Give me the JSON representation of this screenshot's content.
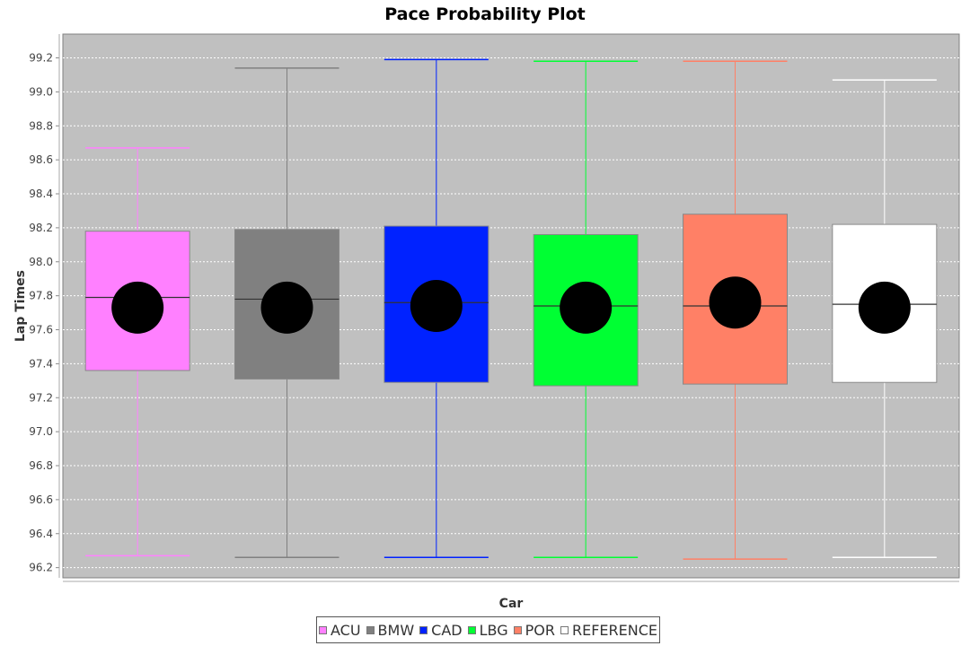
{
  "chart_data": {
    "type": "box",
    "title": "Pace Probability Plot",
    "xlabel": "Car",
    "ylabel": "Lap Times",
    "ylim": [
      96.14,
      99.34
    ],
    "y_ticks": [
      96.2,
      96.4,
      96.6,
      96.8,
      97.0,
      97.2,
      97.4,
      97.6,
      97.8,
      98.0,
      98.2,
      98.4,
      98.6,
      98.8,
      99.0,
      99.2
    ],
    "grid": true,
    "legend_position": "bottom",
    "series": [
      {
        "name": "ACU",
        "color": "#ff80ff",
        "min": 96.27,
        "q1": 97.36,
        "median": 97.79,
        "q3": 98.18,
        "max": 98.67,
        "mean": 97.73
      },
      {
        "name": "BMW",
        "color": "#808080",
        "min": 96.26,
        "q1": 97.31,
        "median": 97.78,
        "q3": 98.19,
        "max": 99.14,
        "mean": 97.73
      },
      {
        "name": "CAD",
        "color": "#0022ff",
        "min": 96.26,
        "q1": 97.29,
        "median": 97.76,
        "q3": 98.21,
        "max": 99.19,
        "mean": 97.74
      },
      {
        "name": "LBG",
        "color": "#00ff33",
        "min": 96.26,
        "q1": 97.27,
        "median": 97.74,
        "q3": 98.16,
        "max": 99.18,
        "mean": 97.73
      },
      {
        "name": "POR",
        "color": "#ff8066",
        "min": 96.25,
        "q1": 97.28,
        "median": 97.74,
        "q3": 98.28,
        "max": 99.18,
        "mean": 97.76
      },
      {
        "name": "REFERENCE",
        "color": "#ffffff",
        "min": 96.26,
        "q1": 97.29,
        "median": 97.75,
        "q3": 98.22,
        "max": 99.07,
        "mean": 97.73
      }
    ]
  }
}
